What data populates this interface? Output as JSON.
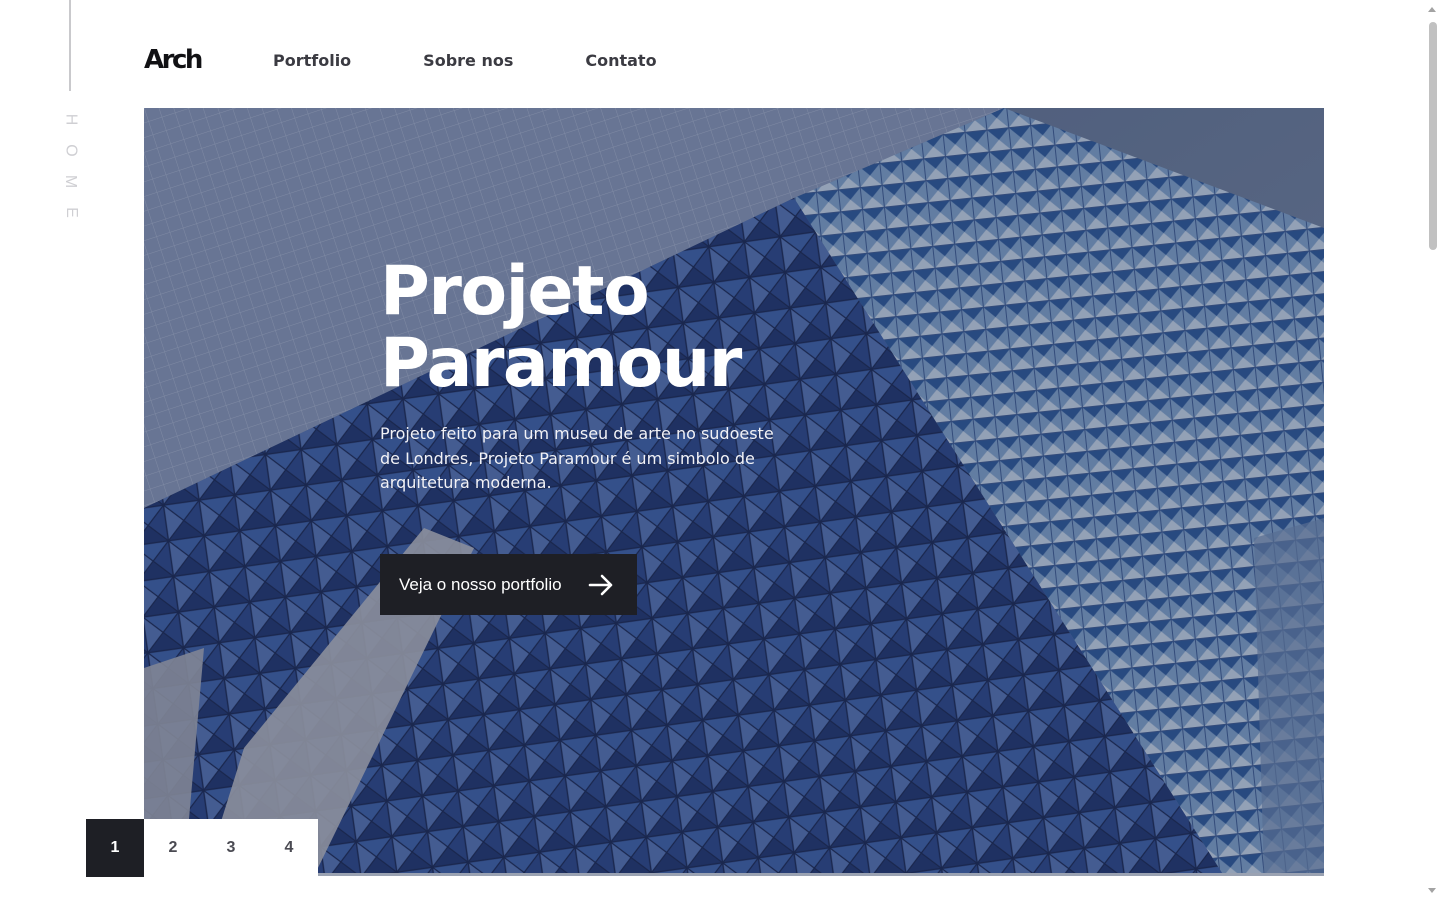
{
  "sidebar": {
    "label_letters": [
      "H",
      "O",
      "M",
      "E"
    ]
  },
  "header": {
    "logo": "Arch",
    "nav": [
      {
        "label": "Portfolio"
      },
      {
        "label": "Sobre nos"
      },
      {
        "label": "Contato"
      }
    ]
  },
  "hero": {
    "title_line1": "Projeto",
    "title_line2": "Paramour",
    "description": "Projeto feito para um museu de arte no sudoeste de Londres, Projeto Paramour é um simbolo de arquitetura moderna.",
    "cta_label": "Veja o nosso portfolio",
    "cta_icon": "arrow-right-icon",
    "background_image": "blue-triangular-glass-building-facade"
  },
  "pager": {
    "pages": [
      "1",
      "2",
      "3",
      "4"
    ],
    "active": "1"
  },
  "colors": {
    "dark": "#1e1f25",
    "nav_text": "#3b3b42",
    "rail_text": "#cfcfd3",
    "facade_blue": "#3d5a9a"
  }
}
